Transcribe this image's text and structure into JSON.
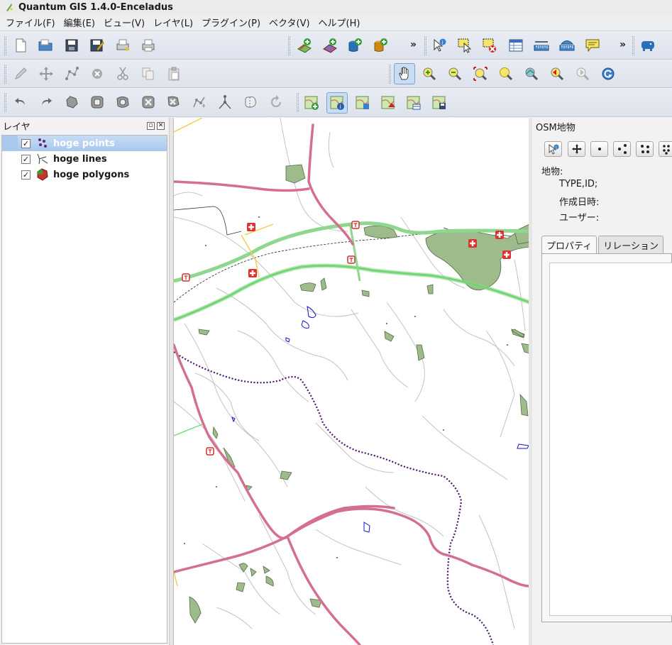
{
  "window": {
    "title": "Quantum GIS 1.4.0-Enceladus"
  },
  "menu": [
    "ファイル(F)",
    "編集(E)",
    "ビュー(V)",
    "レイヤ(L)",
    "プラグイン(P)",
    "ベクタ(V)",
    "ヘルプ(H)"
  ],
  "toolbars": {
    "overflow": "»"
  },
  "layers_panel": {
    "title": "レイヤ",
    "float_glyph": "▫",
    "close_glyph": "✕",
    "check_glyph": "✓",
    "layers": [
      {
        "name": "hoge points",
        "checked": true,
        "selected": true,
        "icon": "points-layer-icon"
      },
      {
        "name": "hoge lines",
        "checked": true,
        "selected": false,
        "icon": "lines-layer-icon"
      },
      {
        "name": "hoge polygons",
        "checked": true,
        "selected": false,
        "icon": "polygons-layer-icon"
      }
    ]
  },
  "osm_panel": {
    "title": "OSM地物",
    "feature_label": "地物:",
    "type_id_label": "TYPE,ID;",
    "created_label": "作成日時:",
    "user_label": "ユーザー:",
    "tabs": [
      {
        "label": "プロパティ",
        "active": true
      },
      {
        "label": "リレーション",
        "active": false
      }
    ]
  },
  "colors": {
    "road_primary": "#d4708f",
    "road_green": "#8fd68f",
    "highway_green": "#4ed84e",
    "forest": "#9dbb8b",
    "water_outline": "#1515cc",
    "boundary": "#4b146e",
    "minor_road": "#bfbfbf",
    "accent_selection": "#a9c8ee"
  }
}
